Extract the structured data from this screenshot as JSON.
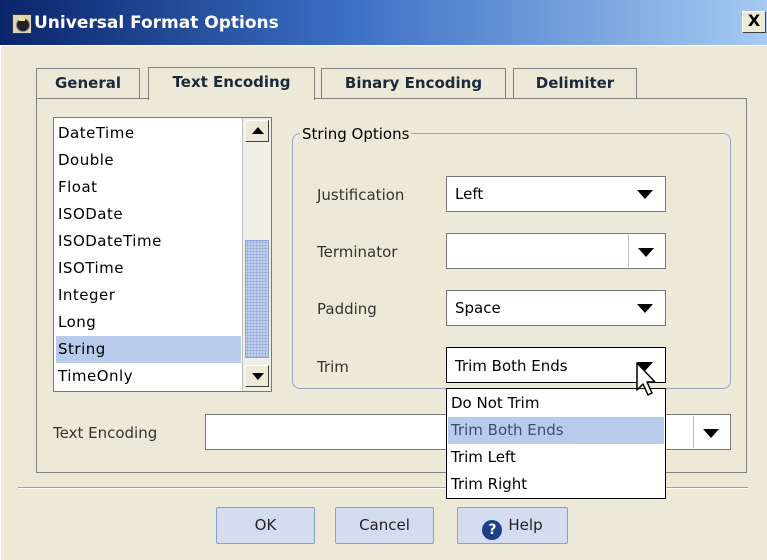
{
  "window": {
    "title": "Universal Format Options",
    "close_label": "X"
  },
  "tabs": [
    {
      "label": "General"
    },
    {
      "label": "Text Encoding",
      "active": true
    },
    {
      "label": "Binary Encoding"
    },
    {
      "label": "Delimiter"
    }
  ],
  "type_list": {
    "items": [
      "DateTime",
      "Double",
      "Float",
      "ISODate",
      "ISODateTime",
      "ISOTime",
      "Integer",
      "Long",
      "String",
      "TimeOnly"
    ],
    "selected": "String"
  },
  "string_options": {
    "group_label": "String Options",
    "justification": {
      "label": "Justification",
      "value": "Left"
    },
    "terminator": {
      "label": "Terminator",
      "value": ""
    },
    "padding": {
      "label": "Padding",
      "value": "Space"
    },
    "trim": {
      "label": "Trim",
      "value": "Trim Both Ends"
    }
  },
  "trim_dropdown": {
    "options": [
      "Do Not Trim",
      "Trim Both Ends",
      "Trim Left",
      "Trim Right"
    ],
    "highlighted": "Trim Both Ends"
  },
  "text_encoding": {
    "label": "Text Encoding",
    "value": ""
  },
  "buttons": {
    "ok": "OK",
    "cancel": "Cancel",
    "help": "Help",
    "help_icon_glyph": "?"
  },
  "colors": {
    "title_gradient_start": "#0a246a",
    "selection": "#b9cbea",
    "dialog_bg": "#ece9d8"
  }
}
